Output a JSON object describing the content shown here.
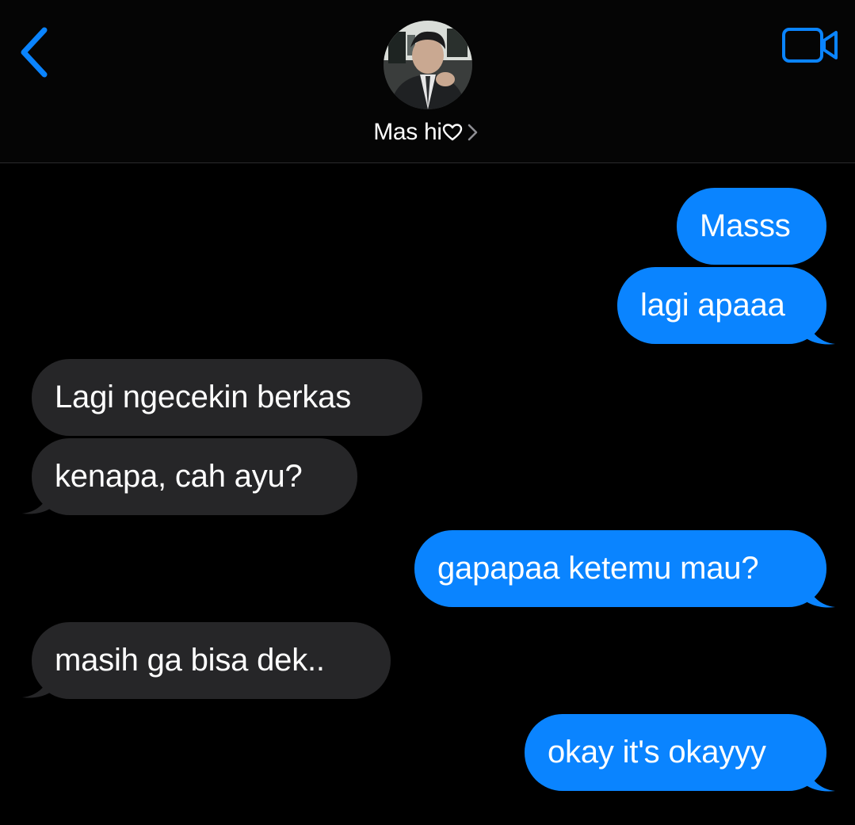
{
  "header": {
    "contact_name": "Mas hi",
    "back_icon": "chevron-left-icon",
    "video_icon": "video-camera-icon",
    "heart_icon": "heart-outline-icon",
    "chevron_icon": "chevron-right-icon"
  },
  "messages": [
    {
      "from": "me",
      "text": "Masss"
    },
    {
      "from": "me",
      "text": "lagi apaaa"
    },
    {
      "from": "them",
      "text": "Lagi ngecekin berkas"
    },
    {
      "from": "them",
      "text": "kenapa, cah ayu?"
    },
    {
      "from": "me",
      "text": "gapapaa ketemu mau?"
    },
    {
      "from": "them",
      "text": "masih ga bisa dek.."
    },
    {
      "from": "me",
      "text": "okay it's okayyy"
    }
  ],
  "colors": {
    "background": "#000000",
    "sent_bubble": "#0a84ff",
    "received_bubble": "#262628",
    "accent": "#0a84ff"
  }
}
